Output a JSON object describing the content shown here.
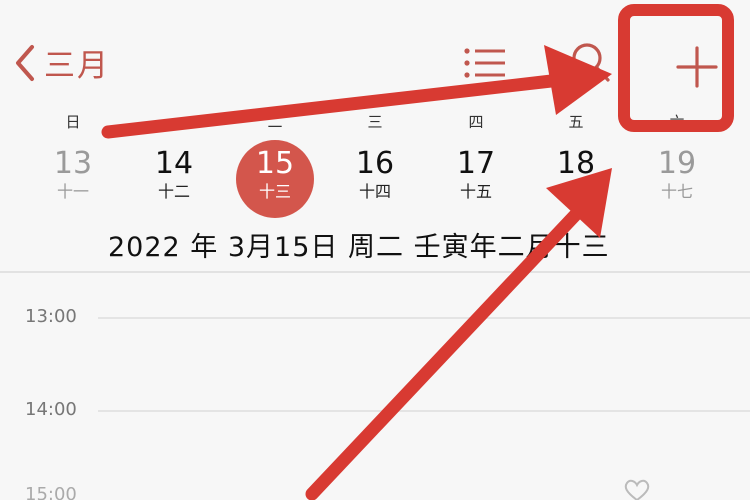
{
  "header": {
    "back_label": "三月",
    "icons": {
      "back": "chevron-left-icon",
      "list": "list-icon",
      "search": "search-icon",
      "add": "plus-icon"
    },
    "accent_color": "#c0574e"
  },
  "weekdays": [
    "日",
    "一",
    "二",
    "三",
    "四",
    "五",
    "六"
  ],
  "days": [
    {
      "num": "13",
      "lunar": "十一",
      "state": "muted"
    },
    {
      "num": "14",
      "lunar": "十二",
      "state": "normal"
    },
    {
      "num": "15",
      "lunar": "十三",
      "state": "selected"
    },
    {
      "num": "16",
      "lunar": "十四",
      "state": "normal"
    },
    {
      "num": "17",
      "lunar": "十五",
      "state": "normal"
    },
    {
      "num": "18",
      "lunar": "十六",
      "state": "normal"
    },
    {
      "num": "19",
      "lunar": "十七",
      "state": "muted"
    }
  ],
  "selected_date_text": "2022 年 3月15日 周二  壬寅年二月十三",
  "timeline": {
    "times": [
      "13:00",
      "14:00"
    ],
    "partial": "15:00"
  },
  "colors": {
    "selected_circle": "#d3564c",
    "annotation": "#d83a32"
  }
}
